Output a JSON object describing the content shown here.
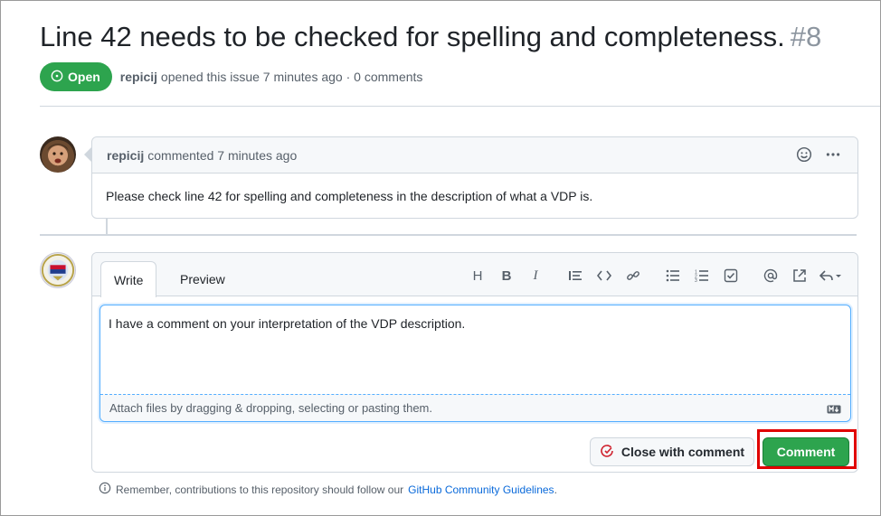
{
  "issue": {
    "title": "Line 42 needs to be checked for spelling and completeness.",
    "number": "#8",
    "state": "Open",
    "author": "repicij",
    "opened_text": "opened this issue 7 minutes ago · 0 comments"
  },
  "comment": {
    "author": "repicij",
    "time_text": "commented 7 minutes ago",
    "body": "Please check line 42 for spelling and completeness in the description of what a VDP is."
  },
  "editor": {
    "tabs": [
      "Write",
      "Preview"
    ],
    "toolbar_icons": [
      "heading-icon",
      "bold-icon",
      "italic-icon",
      "quote-icon",
      "code-icon",
      "link-icon",
      "bulleted-list-icon",
      "numbered-list-icon",
      "task-list-icon",
      "mention-icon",
      "reference-icon",
      "reply-icon"
    ],
    "text": "I have a comment on your interpretation of the VDP description.",
    "attach_hint": "Attach files by dragging & dropping, selecting or pasting them.",
    "close_button": "Close with comment",
    "comment_button": "Comment"
  },
  "footer": {
    "note_prefix": "Remember, contributions to this repository should follow our",
    "link_text": "GitHub Community Guidelines",
    "note_suffix": "."
  },
  "colors": {
    "open_green": "#2da44e",
    "focus_blue": "#54aeff",
    "highlight_red": "#e00000",
    "link_blue": "#0969da"
  }
}
